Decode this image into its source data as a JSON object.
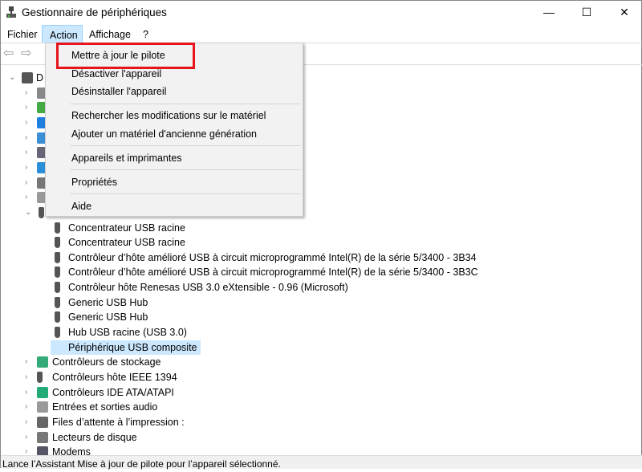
{
  "window": {
    "title": "Gestionnaire de périphériques",
    "minimize": "—",
    "maximize": "☐",
    "close": "✕"
  },
  "menubar": [
    "Fichier",
    "Action",
    "Affichage",
    "?"
  ],
  "toolbar": {
    "back": "⇦",
    "forward": "⇨"
  },
  "action_menu": {
    "items": [
      "Mettre à jour le pilote",
      "Désactiver l'appareil",
      "Désinstaller l'appareil",
      "Rechercher les modifications sur le matériel",
      "Ajouter un matériel d'ancienne génération",
      "Appareils et imprimantes",
      "Propriétés",
      "Aide"
    ],
    "highlighted": "Mettre à jour le pilote",
    "highlight_color": "#e8141c"
  },
  "tree": {
    "root": "D",
    "collapsed_icons": [
      "camera-icon",
      "battery-icon",
      "bluetooth-icon",
      "monitor-icon",
      "computer-icon",
      "network-icon",
      "keyboard-icon",
      "speaker-icon"
    ],
    "usb_children": [
      "Concentrateur USB racine",
      "Concentrateur USB racine",
      "Contrôleur d’hôte amélioré USB à circuit microprogrammé Intel(R) de la série 5/3400 - 3B34",
      "Contrôleur d’hôte amélioré USB à circuit microprogrammé Intel(R) de la série 5/3400 - 3B3C",
      "Contrôleur hôte Renesas USB 3.0 eXtensible - 0.96 (Microsoft)",
      "Generic USB Hub",
      "Generic USB Hub",
      "Hub USB racine (USB 3.0)",
      "Périphérique USB composite"
    ],
    "selected": "Périphérique USB composite",
    "categories": [
      "Contrôleurs de stockage",
      "Contrôleurs hôte IEEE 1394",
      "Contrôleurs IDE ATA/ATAPI",
      "Entrées et sorties audio",
      "Files d’attente à l’impression :",
      "Lecteurs de disque",
      "Modems"
    ]
  },
  "status": "Lance l’Assistant Mise à jour de pilote pour l’appareil sélectionné."
}
